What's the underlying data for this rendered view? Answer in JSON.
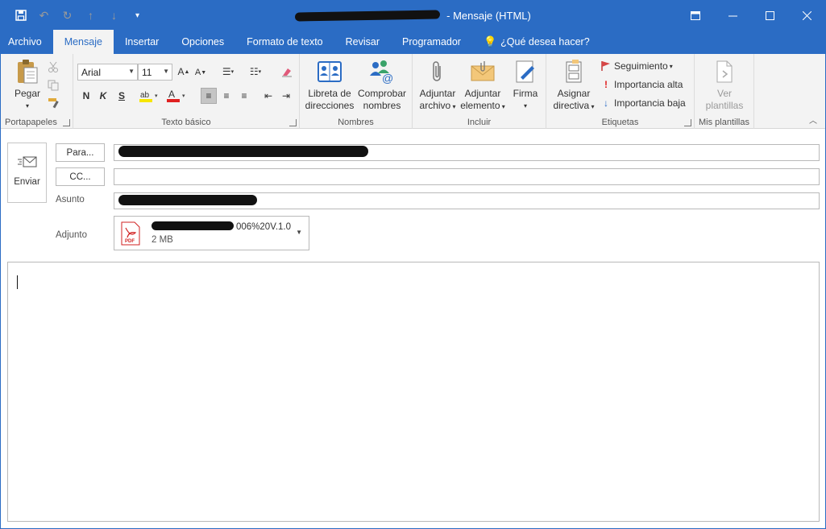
{
  "window": {
    "title_suffix": "- Mensaje (HTML)",
    "controls": [
      "restore-ribbon-icon",
      "minimize-icon",
      "maximize-icon",
      "close-icon"
    ]
  },
  "qat": {
    "items": [
      "save-icon",
      "undo-icon",
      "redo-icon",
      "up-icon",
      "down-icon",
      "customize-icon"
    ]
  },
  "tabs": [
    {
      "label": "Archivo",
      "active": false
    },
    {
      "label": "Mensaje",
      "active": true
    },
    {
      "label": "Insertar",
      "active": false
    },
    {
      "label": "Opciones",
      "active": false
    },
    {
      "label": "Formato de texto",
      "active": false
    },
    {
      "label": "Revisar",
      "active": false
    },
    {
      "label": "Programador",
      "active": false
    }
  ],
  "tell_me": "¿Qué desea hacer?",
  "ribbon": {
    "clipboard": {
      "paste": "Pegar",
      "group": "Portapapeles"
    },
    "basic_text": {
      "font": "Arial",
      "size": "11",
      "bold": "N",
      "italic": "K",
      "strike": "S",
      "group": "Texto básico"
    },
    "names": {
      "address_book_1": "Libreta de",
      "address_book_2": "direcciones",
      "check_names_1": "Comprobar",
      "check_names_2": "nombres",
      "group": "Nombres"
    },
    "include": {
      "attach_file_1": "Adjuntar",
      "attach_file_2": "archivo",
      "attach_item_1": "Adjuntar",
      "attach_item_2": "elemento",
      "signature": "Firma",
      "group": "Incluir"
    },
    "tags": {
      "assign_policy_1": "Asignar",
      "assign_policy_2": "directiva",
      "follow_up": "Seguimiento",
      "high_importance": "Importancia alta",
      "low_importance": "Importancia baja",
      "group": "Etiquetas"
    },
    "templates": {
      "view_1": "Ver",
      "view_2": "plantillas",
      "group": "Mis plantillas"
    }
  },
  "compose": {
    "send": "Enviar",
    "to": "Para...",
    "cc": "CC...",
    "subject_label": "Asunto",
    "attachment_label": "Adjunto",
    "attachment_name": "006%20V.1.0",
    "attachment_size": "2 MB"
  },
  "colors": {
    "accent": "#2b6cc4",
    "ribbon_bg": "#f3f3f3",
    "highlight_yellow": "#f7e600",
    "font_red": "#e02020",
    "pdf_red": "#d12222"
  }
}
